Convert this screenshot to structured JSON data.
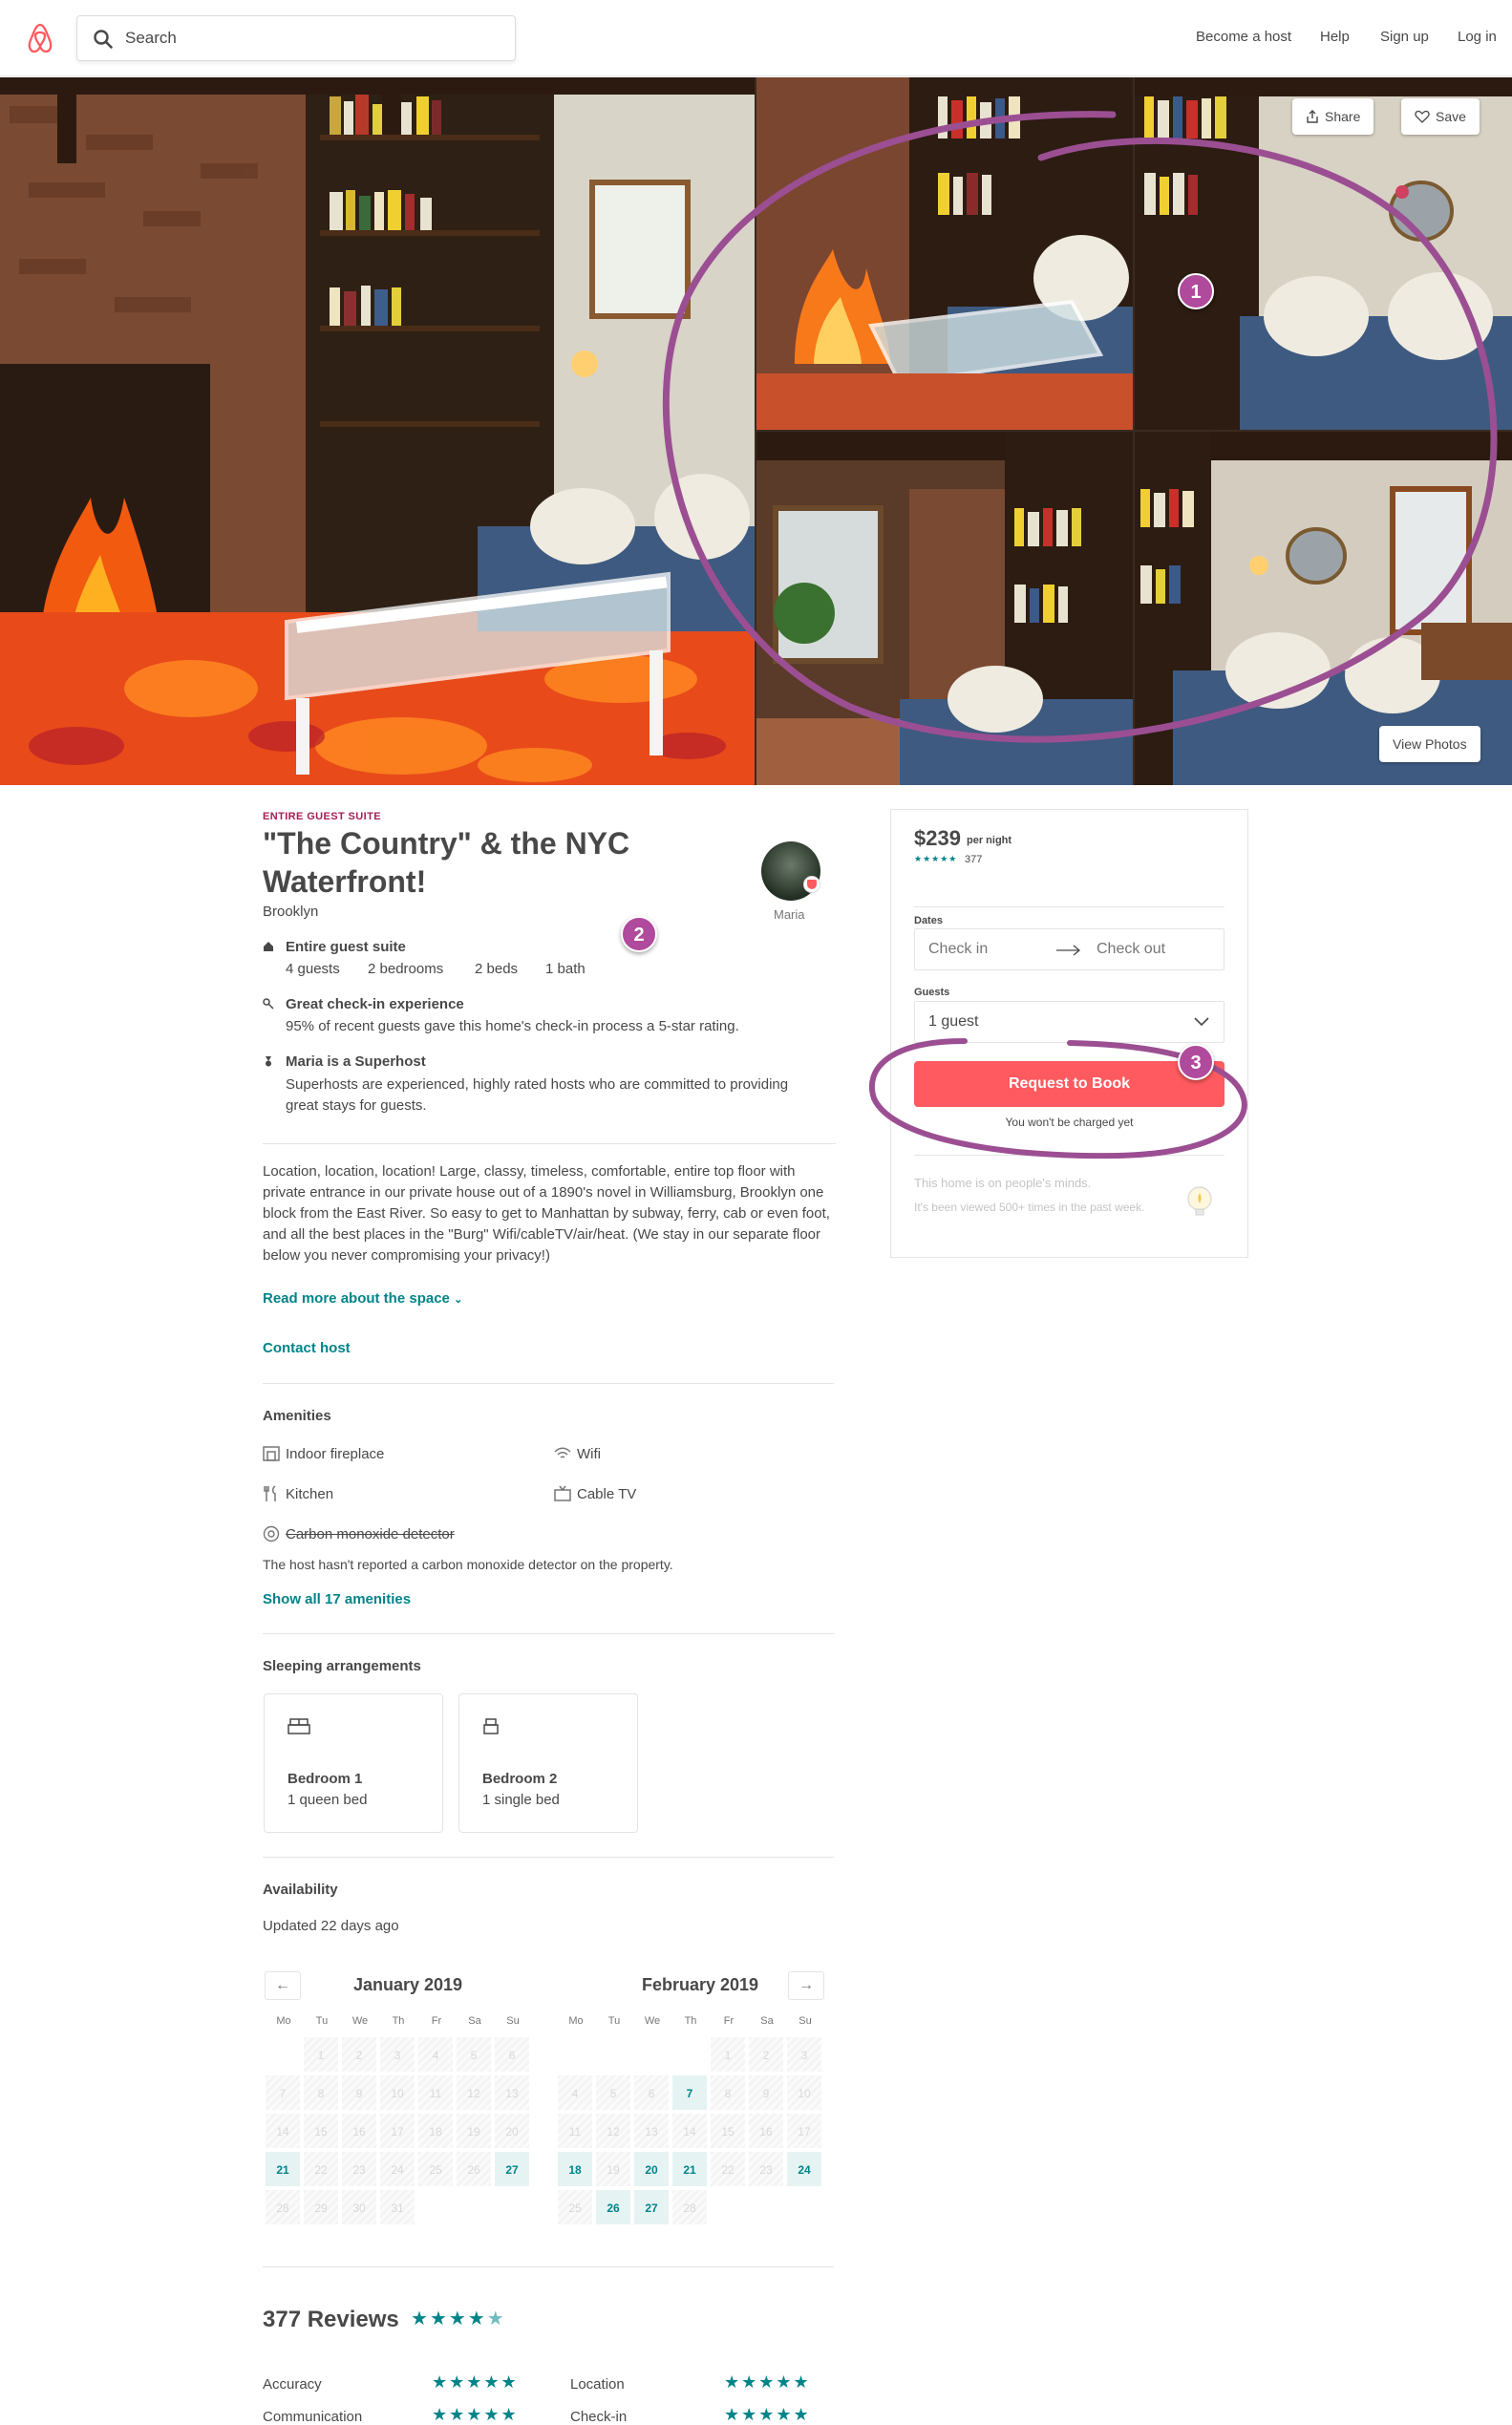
{
  "header": {
    "search_placeholder": "Search",
    "nav": [
      "Become a host",
      "Help",
      "Sign up",
      "Log in"
    ]
  },
  "hero": {
    "share_label": "Share",
    "save_label": "Save",
    "view_photos_label": "View Photos"
  },
  "listing": {
    "kicker": "ENTIRE GUEST SUITE",
    "title": "\"The Country\" & the NYC Waterfront!",
    "location": "Brooklyn",
    "host_name": "Maria",
    "highlights": [
      {
        "title": "Entire guest suite",
        "details": [
          "4 guests",
          "2 bedrooms",
          "2 beds",
          "1 bath"
        ]
      },
      {
        "title": "Great check-in experience",
        "text": "95% of recent guests gave this home's check-in process a 5-star rating."
      },
      {
        "title": "Maria is a Superhost",
        "text": "Superhosts are experienced, highly rated hosts who are committed to providing great stays for guests."
      }
    ],
    "description": "Location, location, location! Large, classy, timeless, comfortable, entire top floor with private entrance in our private house out of a 1890's novel in Williamsburg, Brooklyn one block from the East River. So easy to get to Manhattan by subway, ferry, cab or even foot, and all the best places in the \"Burg\" Wifi/cableTV/air/heat. (We stay in our separate floor below you never compromising your privacy!)",
    "read_more": "Read more about the space",
    "contact_host": "Contact host"
  },
  "amenities": {
    "heading": "Amenities",
    "items": [
      "Indoor fireplace",
      "Wifi",
      "Kitchen",
      "Cable TV"
    ],
    "missing_item": "Carbon monoxide detector",
    "missing_note": "The host hasn't reported a carbon monoxide detector on the property.",
    "show_all": "Show all 17 amenities"
  },
  "sleeping": {
    "heading": "Sleeping arrangements",
    "rooms": [
      {
        "name": "Bedroom 1",
        "bed": "1 queen bed"
      },
      {
        "name": "Bedroom 2",
        "bed": "1 single bed"
      }
    ]
  },
  "availability": {
    "heading": "Availability",
    "updated": "Updated 22 days ago",
    "dow": [
      "Mo",
      "Tu",
      "We",
      "Th",
      "Fr",
      "Sa",
      "Su"
    ],
    "months": [
      {
        "name": "January 2019",
        "offset": 1,
        "days": 31,
        "available": [
          21,
          27
        ]
      },
      {
        "name": "February 2019",
        "offset": 4,
        "days": 28,
        "available": [
          7,
          18,
          20,
          21,
          24,
          26,
          27
        ]
      }
    ]
  },
  "reviews": {
    "heading": "377 Reviews",
    "rating": 4.5,
    "categories": [
      {
        "name": "Accuracy",
        "stars": 5
      },
      {
        "name": "Location",
        "stars": 5
      },
      {
        "name": "Communication",
        "stars": 5
      },
      {
        "name": "Check-in",
        "stars": 5
      }
    ]
  },
  "booking": {
    "price": "$239",
    "per_night": "per night",
    "review_count": "377",
    "dates_label": "Dates",
    "check_in": "Check in",
    "check_out": "Check out",
    "guests_label": "Guests",
    "guests_value": "1 guest",
    "request_label": "Request to Book",
    "no_charge": "You won't be charged yet",
    "minds_title": "This home is on people's minds.",
    "minds_text": "It's been viewed 500+ times in the past week."
  },
  "annotations": [
    "1",
    "2",
    "3"
  ],
  "colors": {
    "brand": "#FF5A5F",
    "teal": "#008489",
    "annotation": "#9B4F92"
  }
}
